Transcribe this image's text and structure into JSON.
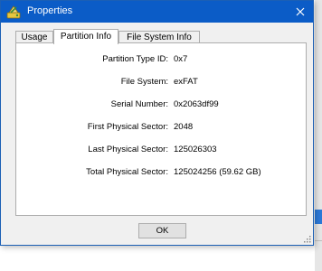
{
  "window": {
    "title": "Properties",
    "titlebar_color": "#0b5cc7",
    "app_icon": "properties-app-icon"
  },
  "tabs": [
    {
      "label": "Usage",
      "active": false
    },
    {
      "label": "Partition Info",
      "active": true
    },
    {
      "label": "File System Info",
      "active": false
    }
  ],
  "partition_info": [
    {
      "label": "Partition Type ID:",
      "value": "0x7"
    },
    {
      "label": "File System:",
      "value": "exFAT"
    },
    {
      "label": "Serial Number:",
      "value": "0x2063df99"
    },
    {
      "label": "First Physical Sector:",
      "value": "2048"
    },
    {
      "label": "Last Physical Sector:",
      "value": "125026303"
    },
    {
      "label": "Total Physical Sector:",
      "value": "125024256 (59.62 GB)"
    }
  ],
  "buttons": {
    "ok_label": "OK"
  }
}
